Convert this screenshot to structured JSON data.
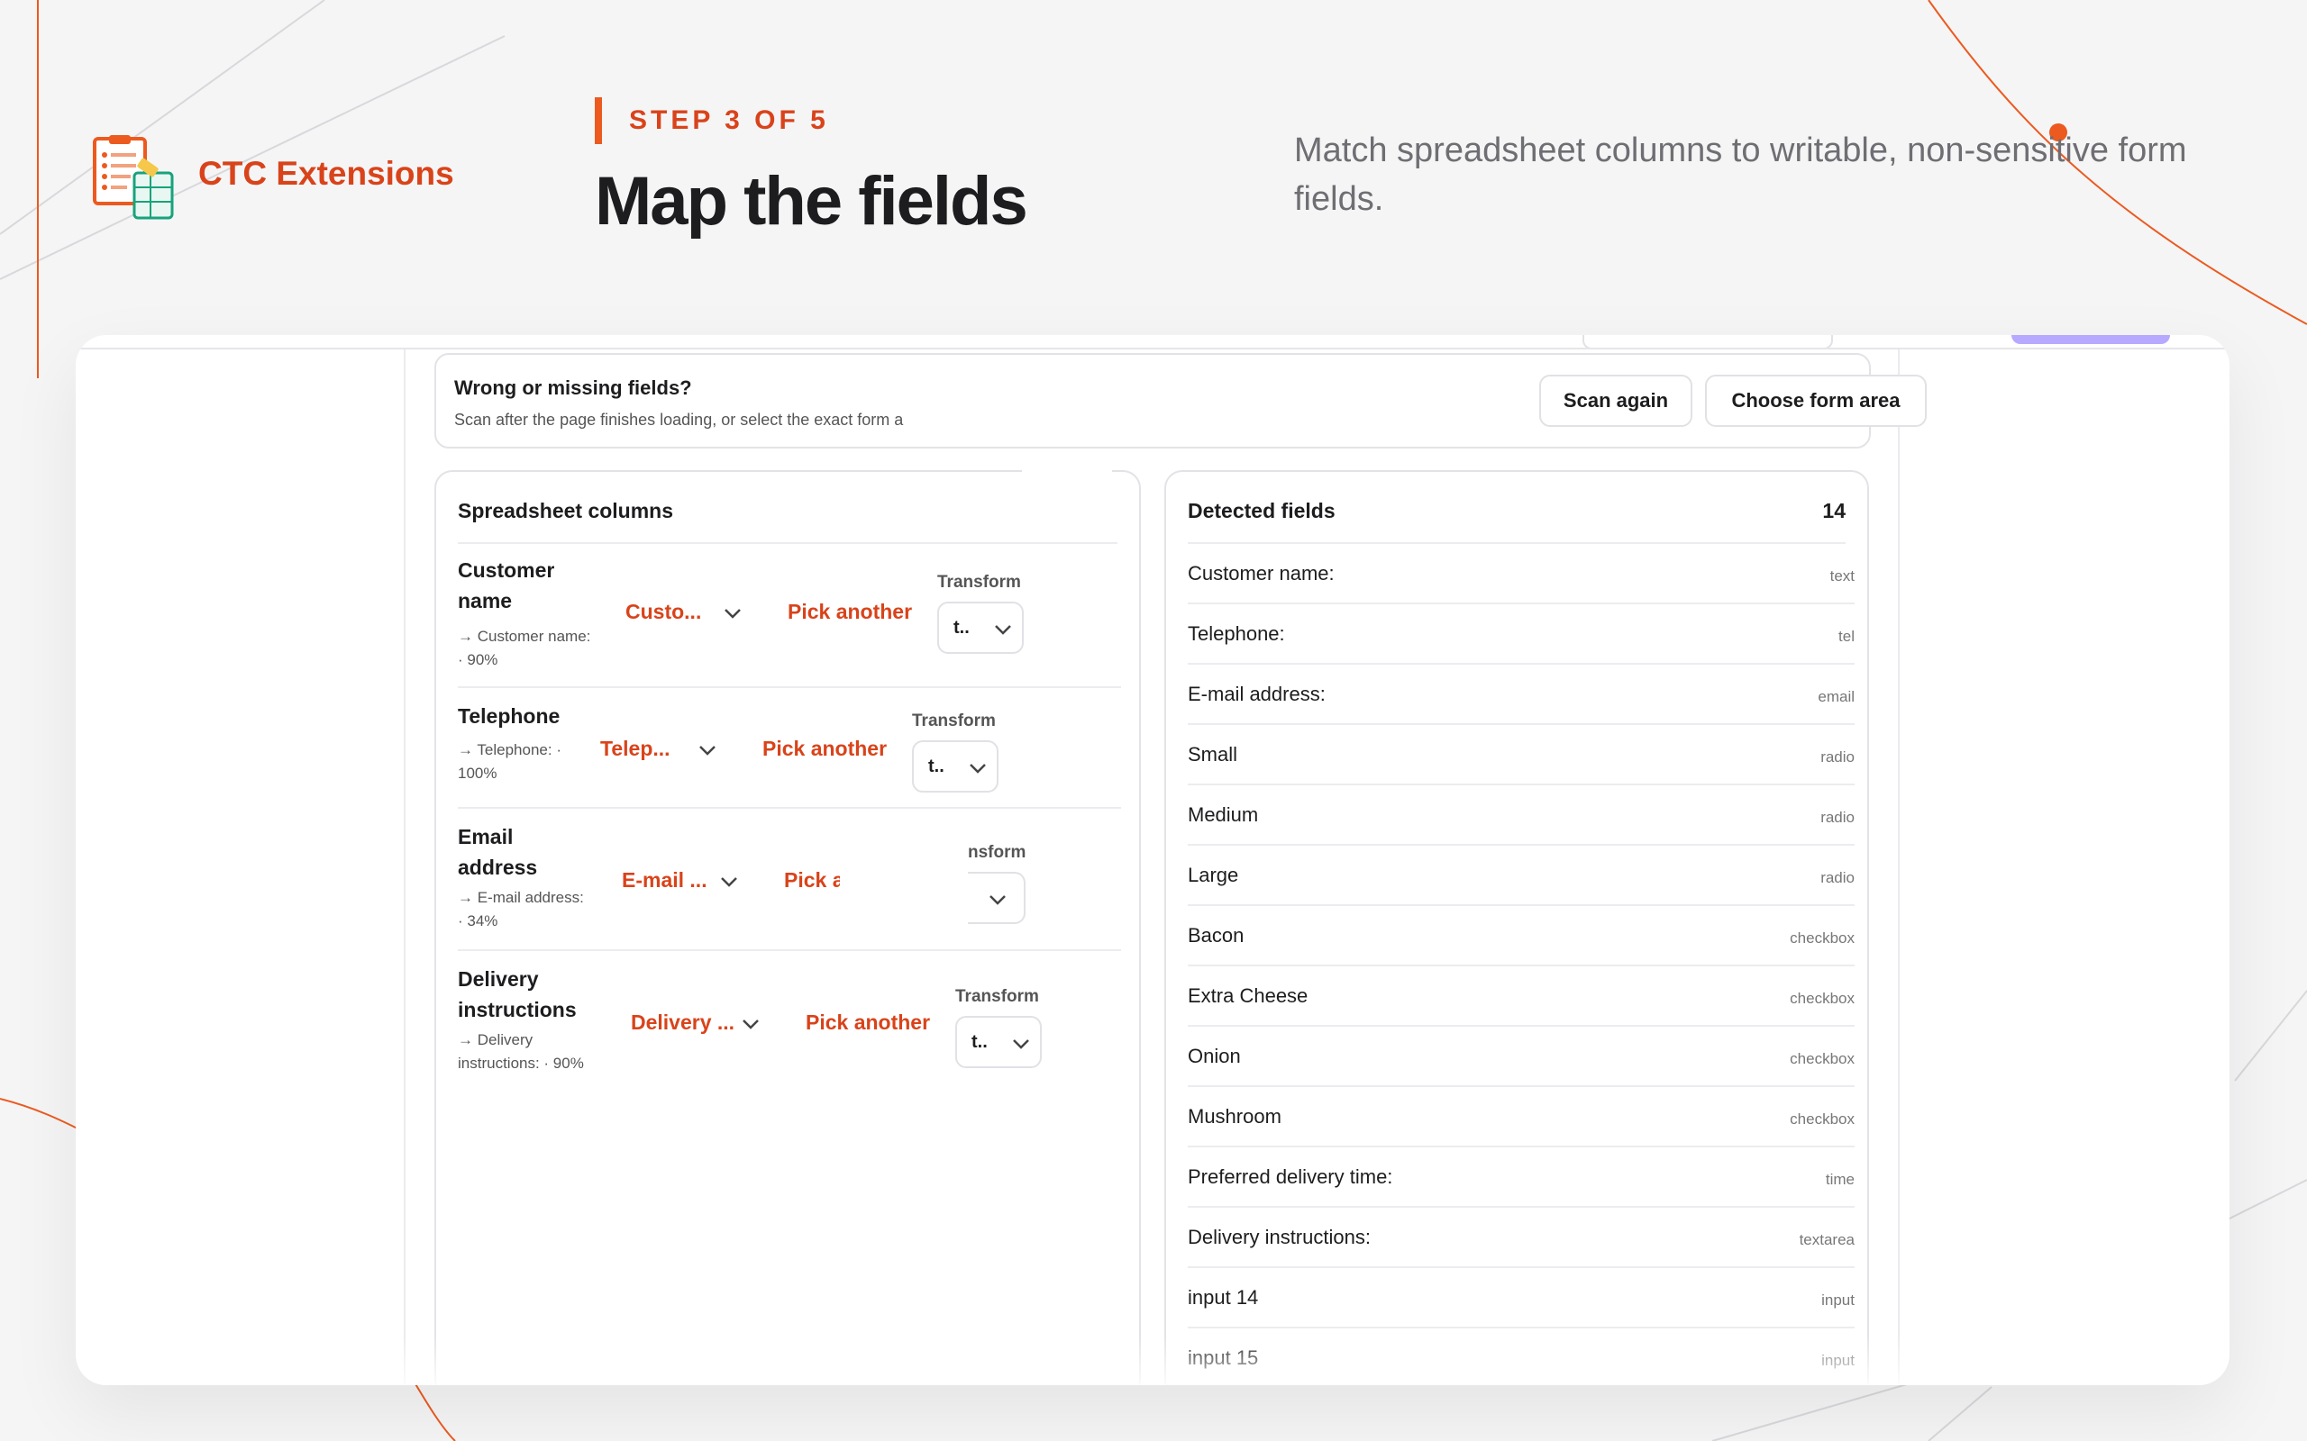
{
  "brand": {
    "name": "CTC Extensions",
    "logo": "spreadsheet-form-logo"
  },
  "header": {
    "step": "STEP 3 OF 5",
    "title": "Map the fields",
    "subtitle": "Match spreadsheet columns to writable, non-sensitive form fields."
  },
  "notice": {
    "title": "Wrong or missing fields?",
    "desc": "Scan after the page finishes loading, or select the exact form a",
    "scan_again": "Scan again",
    "choose_area": "Choose form area"
  },
  "columns_panel": {
    "title": "Spreadsheet columns",
    "rows": [
      {
        "name": "Customer name",
        "match": "→ Customer name: · 90%",
        "mapped": "Custo...",
        "pick": "Pick another",
        "transform_label": "Transform",
        "transform_value": "t.."
      },
      {
        "name": "Telephone",
        "match": "→ Telephone: · 100%",
        "mapped": "Telep...",
        "pick": "Pick another",
        "transform_label": "Transform",
        "transform_value": "t.."
      },
      {
        "name": "Email address",
        "match": "→ E-mail address: · 34%",
        "mapped": "E-mail ...",
        "pick": "Pick a",
        "transform_label": "nsform",
        "transform_value": ""
      },
      {
        "name": "Delivery instructions",
        "match": "→ Delivery instructions: · 90%",
        "mapped": "Delivery ...",
        "pick": "Pick another",
        "transform_label": "Transform",
        "transform_value": "t.."
      }
    ]
  },
  "fields_panel": {
    "title": "Detected fields",
    "count": "14",
    "fields": [
      {
        "name": "Customer name:",
        "type": "text"
      },
      {
        "name": "Telephone:",
        "type": "tel"
      },
      {
        "name": "E-mail address:",
        "type": "email"
      },
      {
        "name": "Small",
        "type": "radio"
      },
      {
        "name": "Medium",
        "type": "radio"
      },
      {
        "name": "Large",
        "type": "radio"
      },
      {
        "name": "Bacon",
        "type": "checkbox"
      },
      {
        "name": "Extra Cheese",
        "type": "checkbox"
      },
      {
        "name": "Onion",
        "type": "checkbox"
      },
      {
        "name": "Mushroom",
        "type": "checkbox"
      },
      {
        "name": "Preferred delivery time:",
        "type": "time"
      },
      {
        "name": "Delivery instructions:",
        "type": "textarea"
      },
      {
        "name": "input 14",
        "type": "input"
      },
      {
        "name": "input 15",
        "type": "input"
      }
    ]
  },
  "colors": {
    "accent": "#d9431a",
    "accent_line": "#ec5a1f",
    "purple": "#b7a9ff"
  }
}
